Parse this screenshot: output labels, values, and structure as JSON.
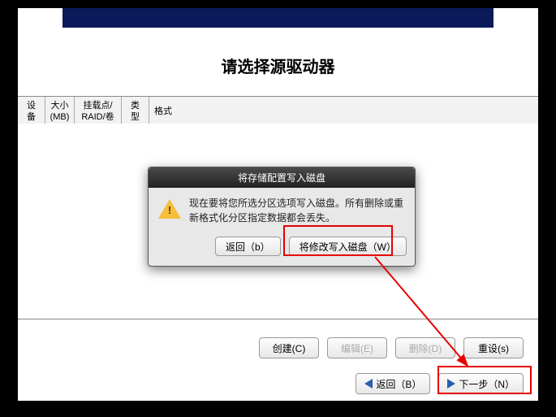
{
  "banner": {},
  "title": "请选择源驱动器",
  "columns": {
    "c0": "设备",
    "c1": "大小\n(MB)",
    "c2": "挂载点/\nRAID/卷",
    "c3": "类型",
    "c4": "格式"
  },
  "dialog": {
    "title": "将存储配置写入磁盘",
    "message": "现在要将您所选分区选项写入磁盘。所有删除或重新格式化分区指定数据都会丢失。",
    "back": "返回（b）",
    "write": "将修改写入磁盘（W）"
  },
  "footer": {
    "create": "创建(C)",
    "edit": "编辑(E)",
    "delete": "删除(D)",
    "reset": "重设(s)"
  },
  "nav": {
    "back": "返回（B）",
    "next": "下一步（N）"
  }
}
